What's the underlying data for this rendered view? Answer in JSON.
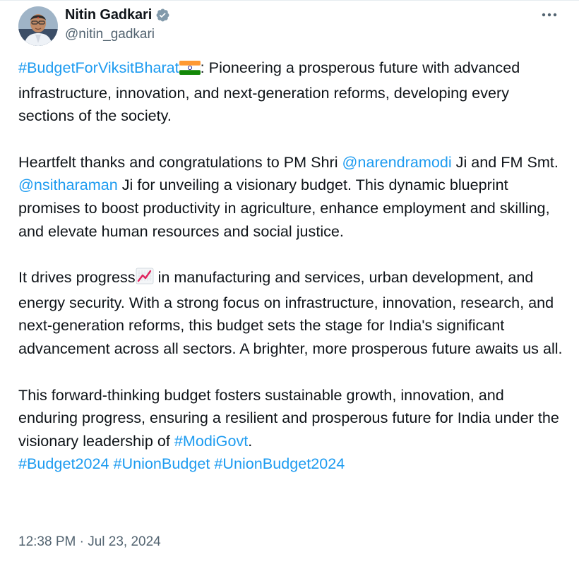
{
  "author": {
    "display_name": "Nitin Gadkari",
    "handle": "@nitin_gadkari",
    "verified": true,
    "avatar_icon": "profile-photo"
  },
  "icons": {
    "verified": "verified-badge-icon",
    "more": "more-options-icon",
    "flag": "india-flag-emoji",
    "chart": "chart-increasing-emoji"
  },
  "colors": {
    "link": "#1d9bf0",
    "text": "#0f1419",
    "secondary": "#536471"
  },
  "tweet": {
    "p1": {
      "hashtag1": "#BudgetForViksitBharat",
      "text1": ": Pioneering a prosperous future with advanced infrastructure, innovation, and next-generation reforms, developing every sections of the society."
    },
    "p2": {
      "text1": "Heartfelt thanks and congratulations to PM Shri ",
      "mention1": "@narendramodi",
      "text2": " Ji and FM Smt. ",
      "mention2": "@nsitharaman",
      "text3": " Ji for unveiling a visionary budget. This dynamic blueprint promises to boost productivity in agriculture, enhance employment and skilling, and elevate human resources and social justice."
    },
    "p3": {
      "text1": "It drives progress",
      "text2": " in manufacturing and services, urban development, and energy security. With a strong focus on infrastructure, innovation, research, and next-generation reforms, this budget sets the stage for India's significant advancement across all sectors. A brighter, more prosperous future awaits us all."
    },
    "p4": {
      "text1": "This forward-thinking budget fosters sustainable growth, innovation, and enduring progress, ensuring a resilient and prosperous future for India under the visionary leadership of ",
      "hashtag1": "#ModiGovt",
      "text2": ".",
      "hashtag2": "#Budget2024",
      "hashtag3": "#UnionBudget",
      "hashtag4": "#UnionBudget2024"
    }
  },
  "meta": {
    "time": "12:38 PM",
    "separator": " · ",
    "date": "Jul 23, 2024"
  }
}
